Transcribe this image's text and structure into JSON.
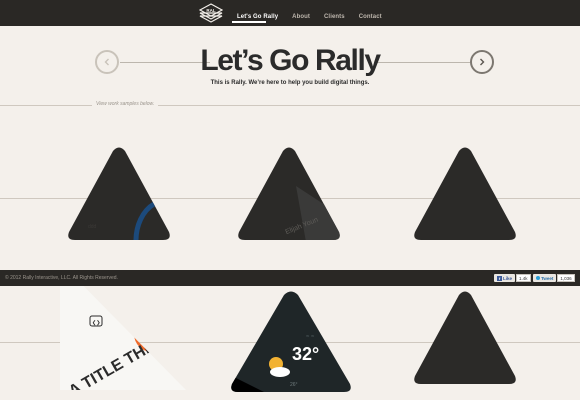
{
  "nav": {
    "logo_text": "RAL",
    "items": [
      {
        "label": "Let's Go Rally",
        "active": true
      },
      {
        "label": "About",
        "active": false
      },
      {
        "label": "Clients",
        "active": false
      },
      {
        "label": "Contact",
        "active": false
      }
    ]
  },
  "hero": {
    "title": "Let’s Go Rally",
    "subtitle": "This is Rally. We’re here to help you build digital things.",
    "prev_icon": "chevron-left-icon",
    "next_icon": "chevron-right-icon"
  },
  "section": {
    "label": "View work samples below."
  },
  "works": {
    "row1": [
      {
        "icon": "work-sample-1"
      },
      {
        "icon": "work-sample-2",
        "visible_text": "Elijah Youn"
      },
      {
        "icon": "work-sample-3"
      }
    ],
    "row2": [
      {
        "icon": "work-sample-4",
        "visible_text": "IS A TITLE THING"
      },
      {
        "icon": "work-sample-5",
        "visible_text": "32°"
      },
      {
        "icon": "work-sample-6"
      }
    ]
  },
  "footer": {
    "copyright": "© 2012 Rally Interactive, LLC. All Rights Reserved.",
    "like_label": "Like",
    "like_count": "1.4k",
    "tweet_label": "Tweet",
    "tweet_count": "1,036"
  },
  "colors": {
    "background": "#f4f0eb",
    "topbar": "#2a2825",
    "text": "#2b2b2b",
    "triangle": "#2b2a28",
    "accent_orange": "#ef6a2a"
  }
}
